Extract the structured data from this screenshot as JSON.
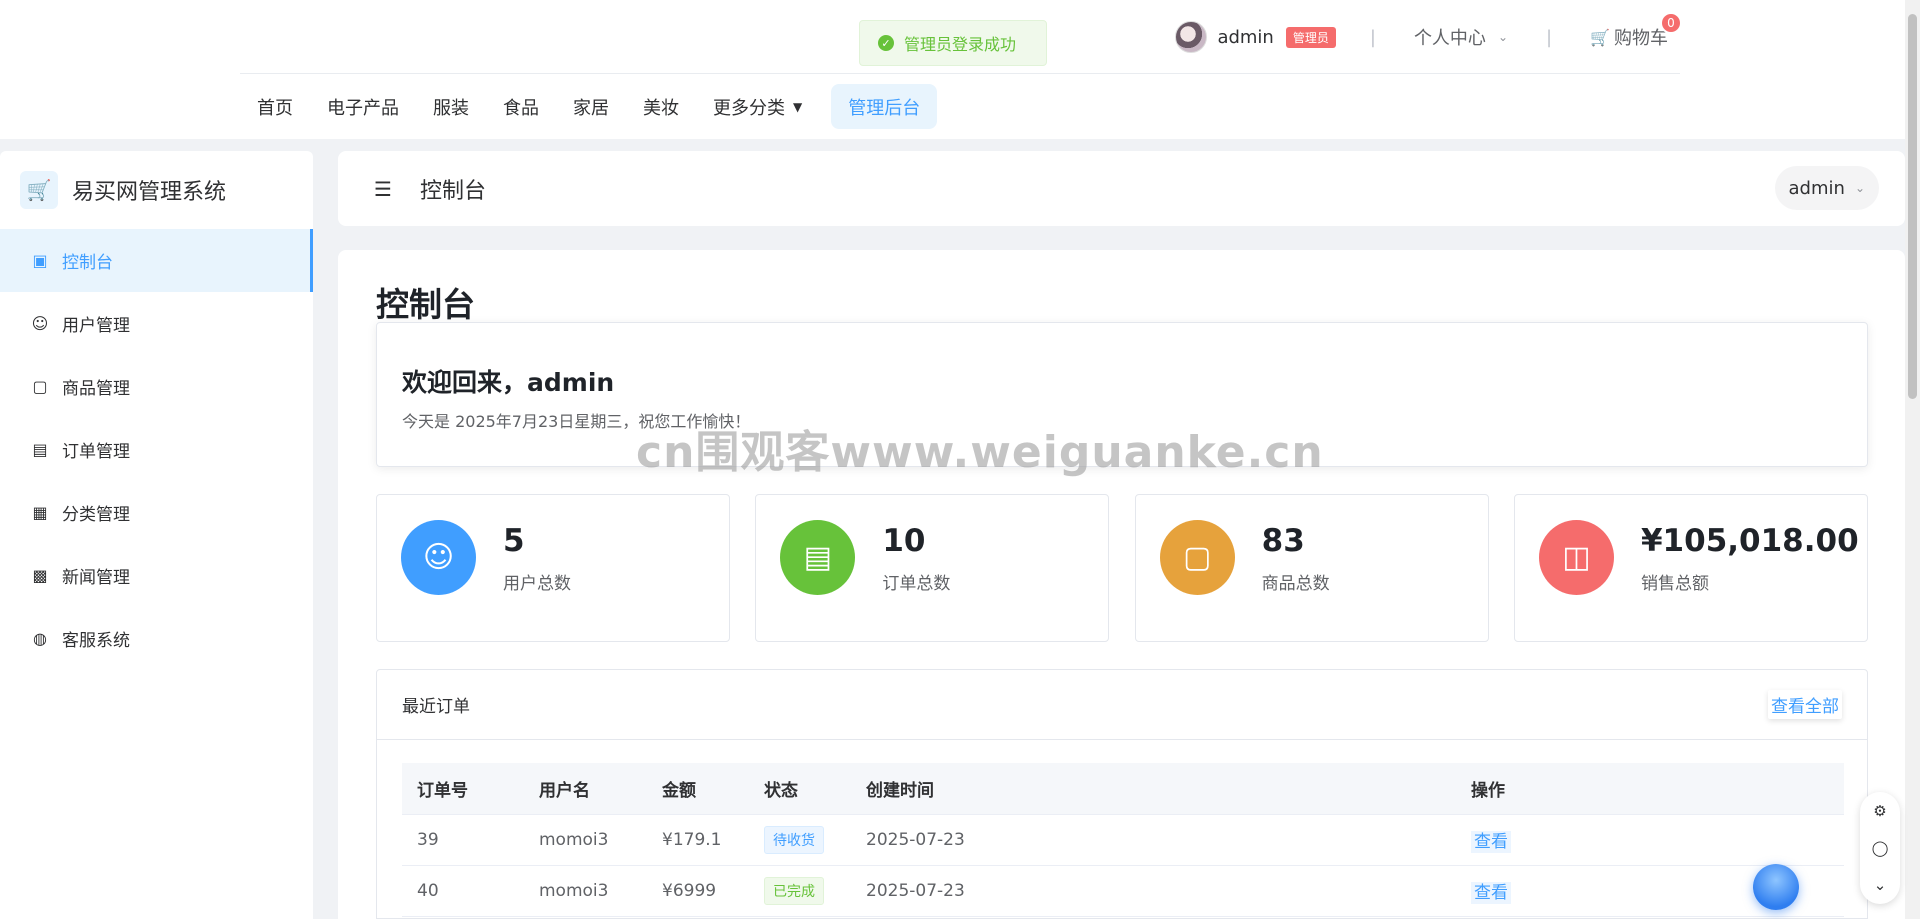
{
  "toast": {
    "message": "管理员登录成功"
  },
  "header": {
    "username": "admin",
    "role_badge": "管理员",
    "separator": "|",
    "personal_center": "个人中心",
    "cart_label": "购物车",
    "cart_count": "0",
    "nav": [
      "首页",
      "电子产品",
      "服装",
      "食品",
      "家居",
      "美妆",
      "更多分类",
      "管理后台"
    ]
  },
  "sidebar": {
    "brand": "易买网管理系统",
    "items": [
      {
        "label": "控制台",
        "icon": "dashboard-icon"
      },
      {
        "label": "用户管理",
        "icon": "user-icon"
      },
      {
        "label": "商品管理",
        "icon": "shopping-bag-icon"
      },
      {
        "label": "订单管理",
        "icon": "clipboard-icon"
      },
      {
        "label": "分类管理",
        "icon": "grid-icon"
      },
      {
        "label": "新闻管理",
        "icon": "document-icon"
      },
      {
        "label": "客服系统",
        "icon": "chat-icon"
      }
    ]
  },
  "topbar": {
    "title": "控制台",
    "user_menu": "admin"
  },
  "main": {
    "page_title": "控制台",
    "welcome_title": "欢迎回来，admin",
    "welcome_text": "今天是 2025年7月23日星期三，祝您工作愉快！",
    "stats": [
      {
        "value": "5",
        "label": "用户总数",
        "color": "#409eff",
        "icon": "user-icon"
      },
      {
        "value": "10",
        "label": "订单总数",
        "color": "#67c23a",
        "icon": "clipboard-icon"
      },
      {
        "value": "83",
        "label": "商品总数",
        "color": "#e6a23c",
        "icon": "shopping-bag-icon"
      },
      {
        "value": "¥105,018.00",
        "label": "销售总额",
        "color": "#f56c6c",
        "icon": "money-icon"
      }
    ],
    "recent_orders": {
      "title": "最近订单",
      "view_all": "查看全部",
      "columns": [
        "订单号",
        "用户名",
        "金额",
        "状态",
        "创建时间",
        "操作"
      ],
      "rows": [
        {
          "id": "39",
          "user": "momoi3",
          "amount": "¥179.1",
          "status": "待收货",
          "created": "2025-07-23",
          "action": "查看"
        },
        {
          "id": "40",
          "user": "momoi3",
          "amount": "¥6999",
          "status": "已完成",
          "created": "2025-07-23",
          "action": "查看"
        }
      ]
    }
  },
  "watermark": "cn围观客www.weiguanke.cn",
  "colors": {
    "primary": "#409eff",
    "success": "#67c23a",
    "warning": "#e6a23c",
    "danger": "#f56c6c"
  }
}
